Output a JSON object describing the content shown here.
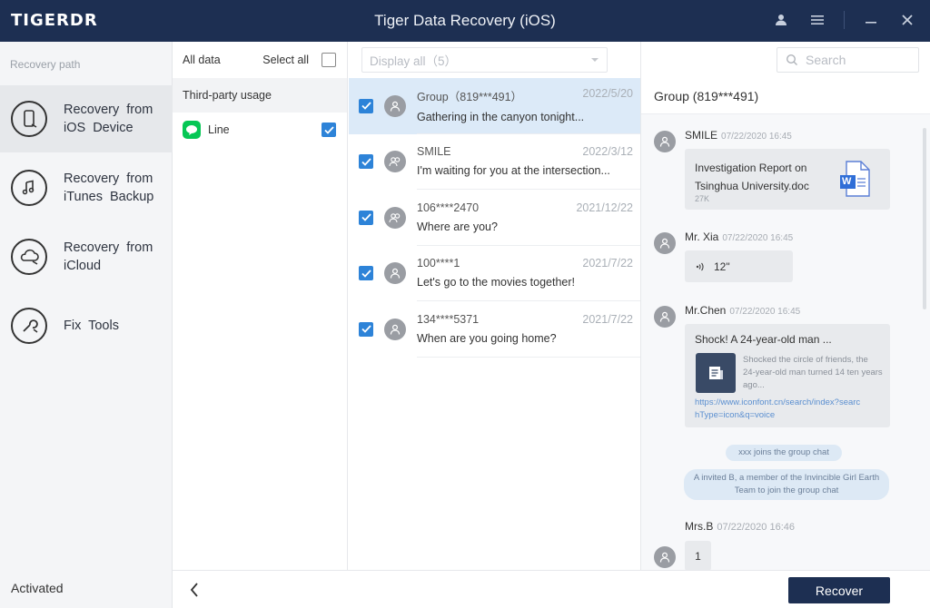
{
  "app": {
    "logo": "TIGERDR",
    "title": "Tiger Data Recovery (iOS)"
  },
  "sidebar": {
    "path_label": "Recovery path",
    "items": [
      {
        "label": "Recovery from iOS Device",
        "icon": "phone-icon",
        "active": true
      },
      {
        "label": "Recovery from iTunes Backup",
        "icon": "music-note-icon",
        "active": false
      },
      {
        "label": "Recovery from iCloud",
        "icon": "cloud-icon",
        "active": false
      },
      {
        "label": "Fix Tools",
        "icon": "wrench-icon",
        "active": false
      }
    ],
    "status": "Activated"
  },
  "datatypes": {
    "all_data_label": "All data",
    "select_all_label": "Select all",
    "section": "Third-party usage",
    "items": [
      {
        "label": "Line",
        "checked": true
      }
    ]
  },
  "list": {
    "filter_value": "Display all（5）",
    "conversations": [
      {
        "name": "Group（819***491）",
        "date": "2022/5/20",
        "preview": "Gathering in the canyon tonight...",
        "selected": true
      },
      {
        "name": "SMILE",
        "date": "2022/3/12",
        "preview": "I'm waiting for you at the intersection...",
        "selected": false
      },
      {
        "name": "106****2470",
        "date": "2021/12/22",
        "preview": "Where are you?",
        "selected": false
      },
      {
        "name": "100****1",
        "date": "2021/7/22",
        "preview": "Let's go to the movies together!",
        "selected": false
      },
      {
        "name": "134****5371",
        "date": "2021/7/22",
        "preview": "When are you going home?",
        "selected": false
      }
    ]
  },
  "search": {
    "placeholder": "Search"
  },
  "chat": {
    "title": "Group (819***491)",
    "messages": [
      {
        "sender": "SMILE",
        "time": "07/22/2020  16:45",
        "file_name": "Investigation Report on Tsinghua University.doc",
        "file_size": "27K",
        "file_badge": "W"
      },
      {
        "sender": "Mr. Xia",
        "time": "07/22/2020  16:45",
        "voice": "12\""
      },
      {
        "sender": "Mr.Chen",
        "time": "07/22/2020  16:45",
        "link_title": "Shock! A 24-year-old man ...",
        "link_desc": "Shocked the circle of friends, the 24-year-old man turned 14 ten years ago...",
        "link_url": "https://www.iconfont.cn/search/index?searchType=icon&q=voice"
      },
      {
        "sender": "Mrs.B",
        "time": "07/22/2020  16:46",
        "text": "1"
      }
    ],
    "system_notes": [
      "xxx joins the group chat",
      "A invited B, a member of the Invincible Girl Earth Team to join the group chat"
    ]
  },
  "footer": {
    "recover_label": "Recover"
  },
  "colors": {
    "titlebar": "#1d2f52",
    "accent": "#2d83d8",
    "line_green": "#06c755"
  }
}
